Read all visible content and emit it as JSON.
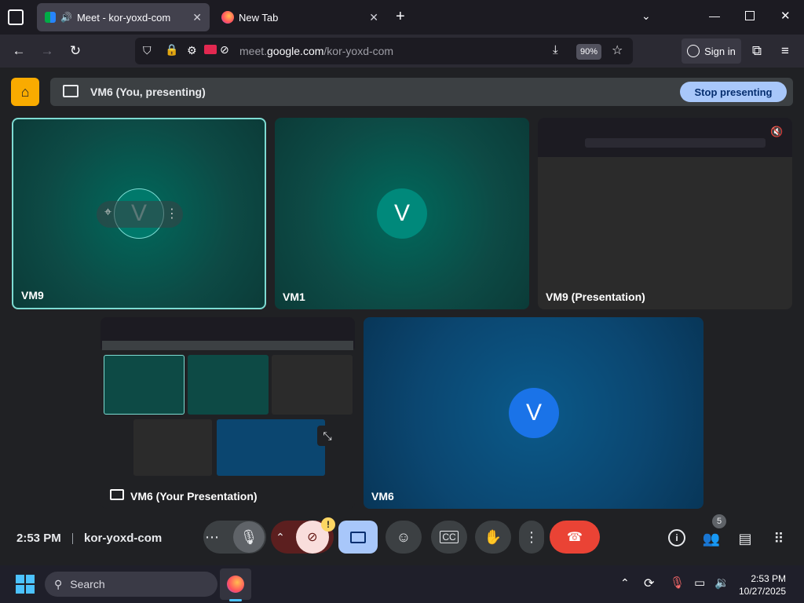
{
  "browser": {
    "tabs": [
      {
        "title": "Meet - kor-yoxd-com",
        "active": true
      },
      {
        "title": "New Tab",
        "active": false
      }
    ],
    "url_prefix": "meet.",
    "url_domain": "google.com",
    "url_path": "/kor-yoxd-com",
    "zoom": "90%",
    "signin_label": "Sign in"
  },
  "meet": {
    "presenting_text": "VM6 (You, presenting)",
    "stop_label": "Stop presenting",
    "tiles": [
      {
        "name": "VM9",
        "initial": "V"
      },
      {
        "name": "VM1",
        "initial": "V"
      },
      {
        "name": "VM9 (Presentation)"
      },
      {
        "name": "VM6 (Your Presentation)"
      },
      {
        "name": "VM6",
        "initial": "V"
      }
    ],
    "time": "2:53 PM",
    "meeting_code": "kor-yoxd-com",
    "participant_count": "5",
    "camera_warning": "!"
  },
  "taskbar": {
    "search_label": "Search",
    "time": "2:53 PM",
    "date": "10/27/2025"
  },
  "colors": {
    "accent": "#a8c7fa",
    "end_call": "#ea4335",
    "cam_off": "#f9dedc",
    "present_active": "#a8c7fa"
  }
}
